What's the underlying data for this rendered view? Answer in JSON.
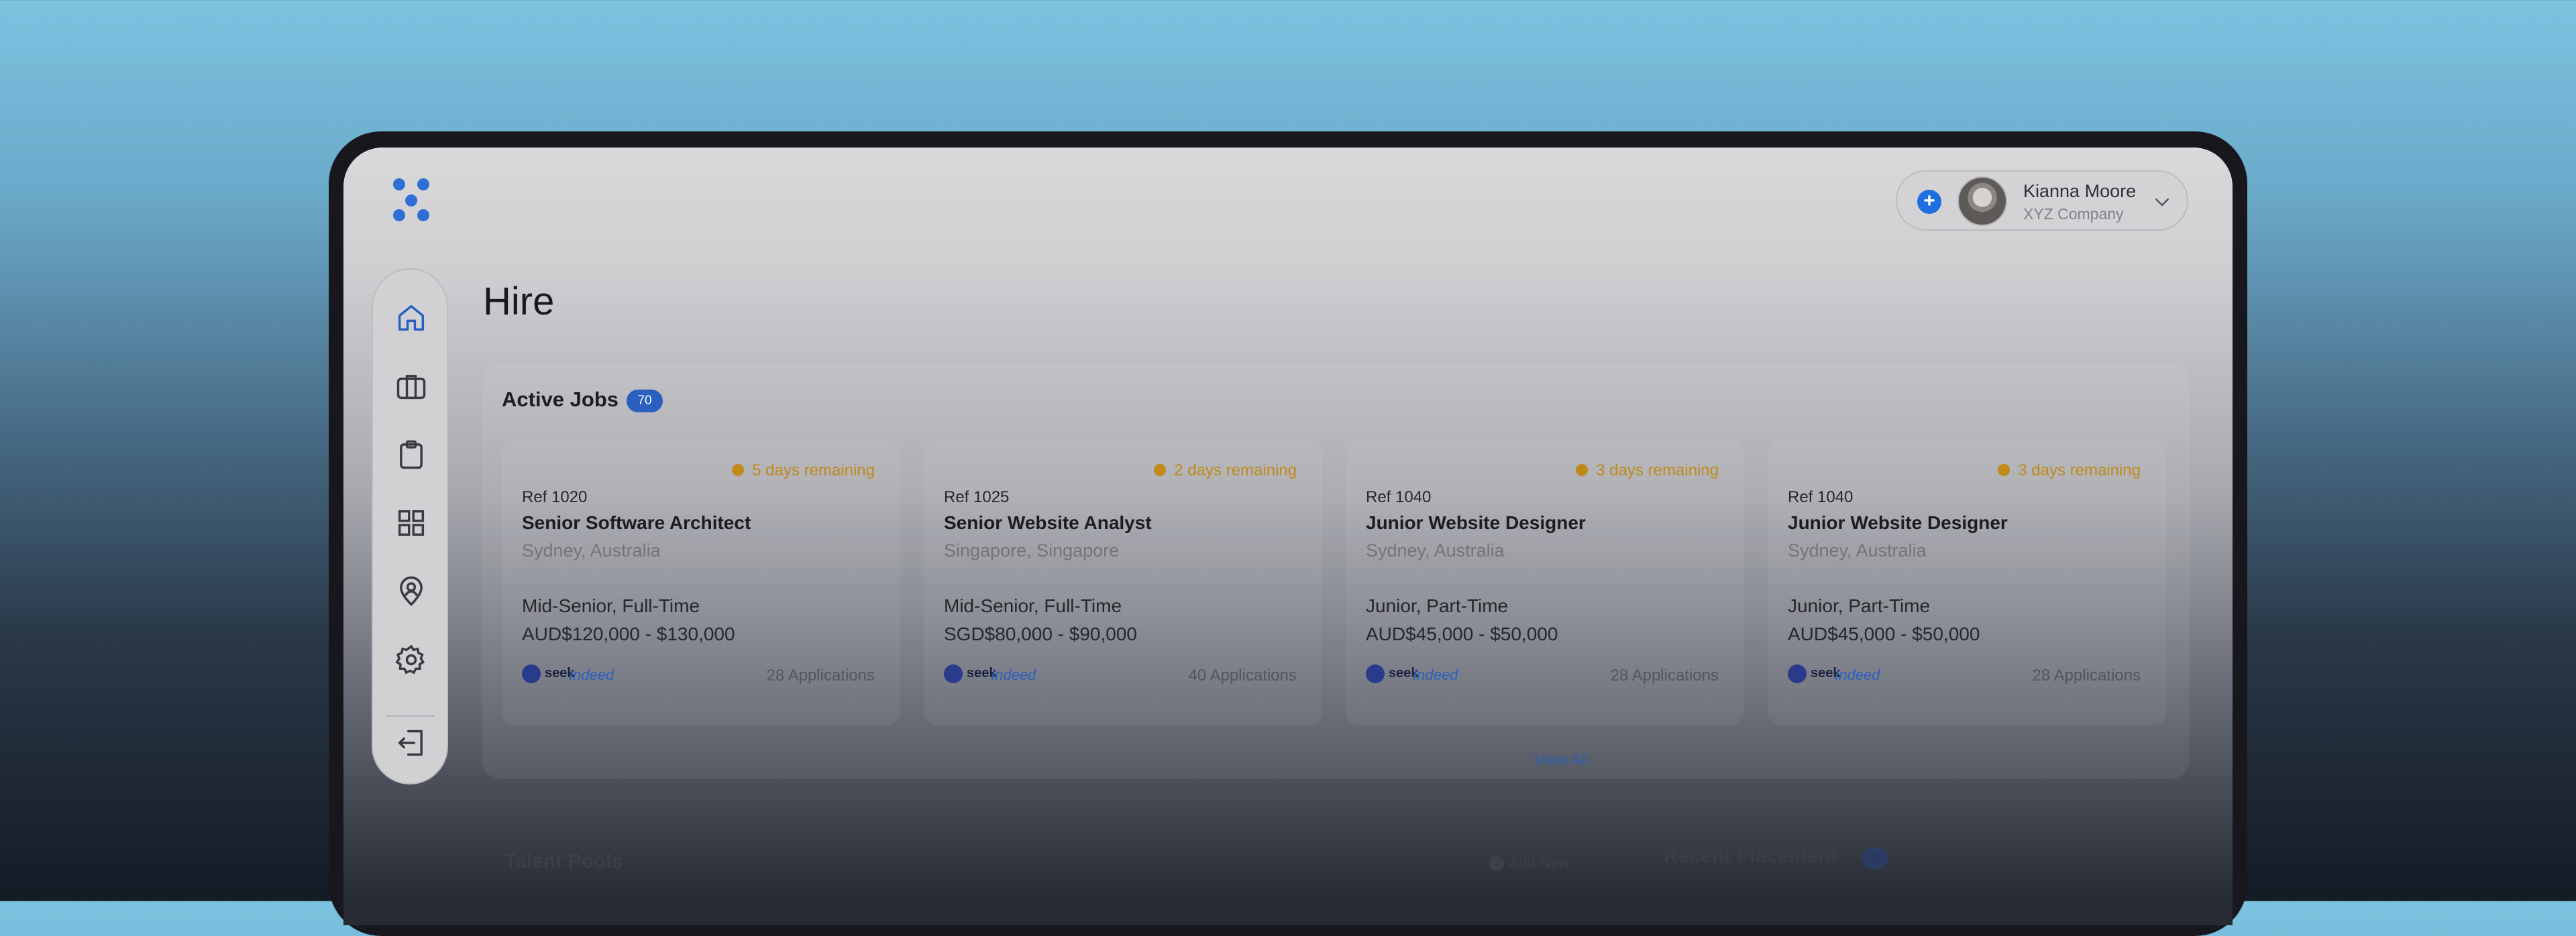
{
  "header": {
    "user_name": "Kianna Moore",
    "company": "XYZ Company",
    "add_icon": "plus-icon",
    "dropdown_icon": "chevron-down-icon"
  },
  "sidebar": {
    "items": [
      {
        "icon": "home-icon",
        "active": true
      },
      {
        "icon": "briefcase-icon",
        "active": false
      },
      {
        "icon": "clipboard-icon",
        "active": false
      },
      {
        "icon": "grid-icon",
        "active": false
      },
      {
        "icon": "location-user-icon",
        "active": false
      },
      {
        "icon": "gear-icon",
        "active": false
      },
      {
        "icon": "logout-icon",
        "active": false
      }
    ]
  },
  "page": {
    "title": "Hire"
  },
  "active_jobs": {
    "title": "Active Jobs",
    "count": "70",
    "view_all": "View All",
    "jobs": [
      {
        "remaining": "5 days remaining",
        "ref": "Ref 1020",
        "title": "Senior Software Architect",
        "location": "Sydney, Australia",
        "type": "Mid-Senior, Full-Time",
        "salary": "AUD$120,000 - $130,000",
        "applications": "28 Applications",
        "seek": "seek",
        "indeed": "Indeed"
      },
      {
        "remaining": "2 days remaining",
        "ref": "Ref 1025",
        "title": "Senior Website Analyst",
        "location": "Singapore, Singapore",
        "type": "Mid-Senior, Full-Time",
        "salary": "SGD$80,000 - $90,000",
        "applications": "40 Applications",
        "seek": "seek",
        "indeed": "Indeed"
      },
      {
        "remaining": "3 days remaining",
        "ref": "Ref 1040",
        "title": "Junior Website Designer",
        "location": "Sydney, Australia",
        "type": "Junior, Part-Time",
        "salary": "AUD$45,000 - $50,000",
        "applications": "28 Applications",
        "seek": "seek",
        "indeed": "Indeed"
      },
      {
        "remaining": "3 days remaining",
        "ref": "Ref 1040",
        "title": "Junior Website Designer",
        "location": "Sydney, Australia",
        "type": "Junior, Part-Time",
        "salary": "AUD$45,000 - $50,000",
        "applications": "28 Applications",
        "seek": "seek",
        "indeed": "Indeed"
      }
    ]
  },
  "talent_pools": {
    "title": "Talent Pools",
    "add_new": "Add New"
  },
  "recent_placement": {
    "title": "Recent Placement",
    "count": "0"
  },
  "colors": {
    "accent": "#2a5fc0",
    "warning": "#c08a1a",
    "device_frame": "#17171d"
  }
}
